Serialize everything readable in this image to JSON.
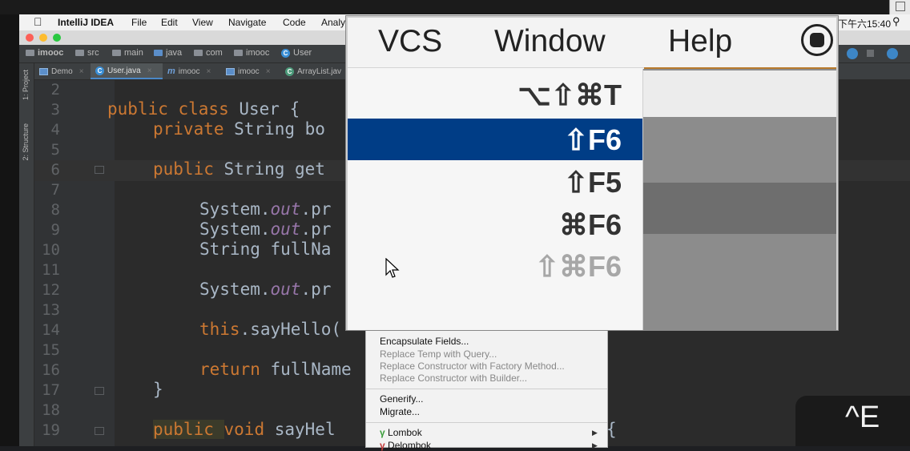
{
  "menubar": {
    "app": "IntelliJ IDEA",
    "items": [
      "File",
      "Edit",
      "View",
      "Navigate",
      "Code",
      "Analy"
    ],
    "clock": "下午六15:40"
  },
  "breadcrumbs": [
    "imooc",
    "src",
    "main",
    "java",
    "com",
    "imooc",
    "User"
  ],
  "side_labels": [
    "1: Project",
    "2: Structure"
  ],
  "tabs": [
    "Demo",
    "User.java",
    "imooc",
    "imooc",
    "ArrayList.jav"
  ],
  "code_lines": [
    {
      "n": "2",
      "text": ""
    },
    {
      "n": "3",
      "kw": "public class ",
      "rest": "User {"
    },
    {
      "n": "4",
      "kw": "private ",
      "rest": "String bo"
    },
    {
      "n": "5",
      "text": ""
    },
    {
      "n": "6",
      "kw": "public ",
      "rest": "String get"
    },
    {
      "n": "7",
      "text": ""
    },
    {
      "n": "8",
      "pre": "System.",
      "it": "out",
      "post": ".pr"
    },
    {
      "n": "9",
      "pre": "System.",
      "it": "out",
      "post": ".pr"
    },
    {
      "n": "10",
      "text": "String fullNa"
    },
    {
      "n": "11",
      "text": ""
    },
    {
      "n": "12",
      "pre": "System.",
      "it": "out",
      "post": ".pr"
    },
    {
      "n": "13",
      "text": ""
    },
    {
      "n": "14",
      "kw": "this",
      "rest": ".sayHello("
    },
    {
      "n": "15",
      "text": ""
    },
    {
      "n": "16",
      "kw": "return ",
      "rest": "fullName"
    },
    {
      "n": "17",
      "text": "}"
    },
    {
      "n": "18",
      "text": ""
    },
    {
      "n": "19",
      "kw": "public ",
      "kw2": "void ",
      "rest": "sayHel"
    }
  ],
  "context_menu": {
    "items": [
      "Encapsulate Fields...",
      "Replace Temp with Query...",
      "Replace Constructor with Factory Method...",
      "Replace Constructor with Builder...",
      "Generify...",
      "Migrate...",
      "Lombok",
      "Delombok"
    ],
    "brace": "{"
  },
  "zoom": {
    "menus": [
      "VCS",
      "Window",
      "Help"
    ],
    "shortcuts": [
      "⌥⇧⌘T",
      "⇧F6",
      "⇧F5",
      "⌘F6",
      "⇧⌘F6"
    ]
  },
  "key_overlay": "^E"
}
